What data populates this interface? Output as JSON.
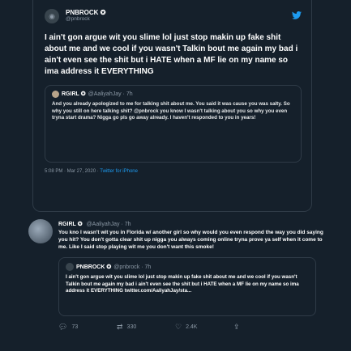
{
  "main_tweet": {
    "name": "PNBROCK",
    "badge": "✪",
    "handle": "@pnbrock",
    "text": "I ain't gon argue wit you slime lol just stop makin up fake shit about me and we cool if you wasn't Talkin bout me again my bad i ain't even see the shit but i HATE when a MF lie on my name so ima address it EVERYTHING",
    "timestamp": "5:08 PM · Mar 27, 2020 · ",
    "source": "Twitter for iPhone"
  },
  "quoted_tweet": {
    "name": "RGIRL",
    "badge": "✪",
    "meta": "@AaliyahJay · 7h",
    "text": "And you already apologized to me for talking shit about me. You said it was cause you was salty. So why you still on here talking shit? @pnbrock you know I wasn't talking about you so why you even tryna start drama? Nigga go pls go away already. I haven't responded to you in years!"
  },
  "reply_tweet": {
    "name": "RGIRL",
    "badge": "✪",
    "meta": "@AaliyahJay · 7h",
    "text": "You kno I wasn't wit you in Florida w/ another girl so why would you even respond the way you did saying you hit? You don't gotta clear shit up nigga you always coming online tryna prove ya self when it come to me. Like I said stop playing wit me you don't want this smoke!"
  },
  "nested_quote": {
    "name": "PNBROCK",
    "badge": "✪",
    "meta": "@pnbrock · 7h",
    "text": "I ain't gon argue wit you slime lol just stop makin up fake shit about me and we cool if you wasn't Talkin bout me again my bad i ain't even see the shit but i HATE when a MF lie on my name so ima address it EVERYTHING twitter.com/AaliyahJay/sta..."
  },
  "actions": {
    "replies": "73",
    "retweets": "330",
    "likes": "2.4K"
  },
  "icons": {
    "twitter": "twitter-bird-icon",
    "reply": "reply-icon",
    "retweet": "retweet-icon",
    "like": "heart-icon",
    "share": "share-icon"
  },
  "colors": {
    "background": "#15202b",
    "accent": "#1d9bf0",
    "muted": "#8b98a5",
    "border": "#2f3b47"
  }
}
